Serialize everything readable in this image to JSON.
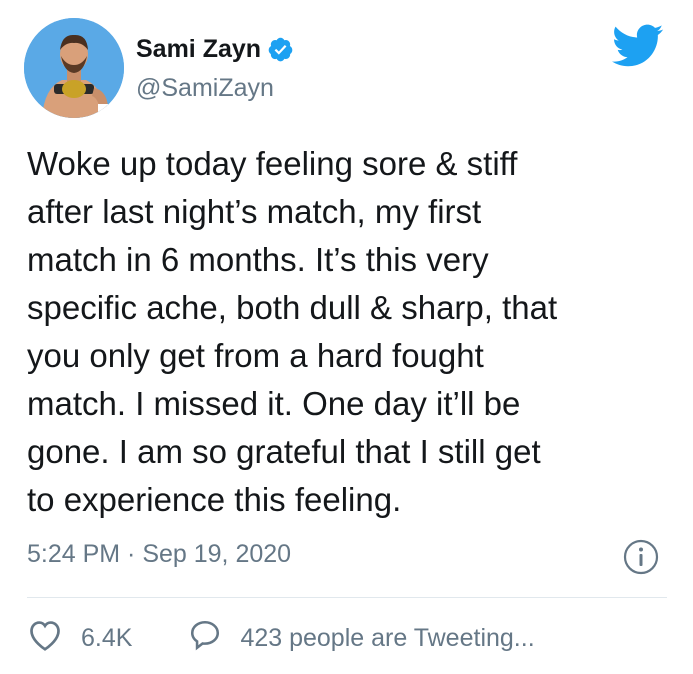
{
  "user": {
    "display_name": "Sami Zayn",
    "handle": "@SamiZayn",
    "verified": true
  },
  "tweet": {
    "lines": [
      "Woke up today feeling sore & stiff",
      "after last night’s match, my first",
      "match in 6 months. It’s this very",
      "specific ache, both dull & sharp, that",
      "you only get from a hard fought",
      "match. I missed it. One day it’ll be",
      "gone. I am so grateful that I still get",
      "to experience this feeling."
    ],
    "timestamp": "5:24 PM · Sep 19, 2020"
  },
  "actions": {
    "likes": "6.4K",
    "conversation": "423 people are Tweeting..."
  },
  "icons": {
    "brand": "twitter-bird-icon",
    "verified": "verified-badge-icon",
    "info": "info-icon",
    "like": "heart-icon",
    "reply": "speech-bubble-icon"
  },
  "colors": {
    "brand_blue": "#1da1f2",
    "text_primary": "#14171a",
    "text_secondary": "#657786",
    "divider": "#e1e8ed"
  }
}
